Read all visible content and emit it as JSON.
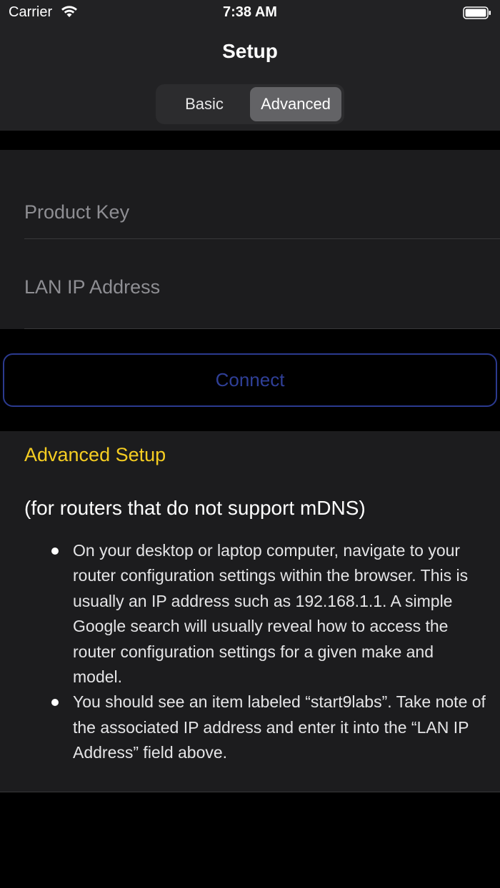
{
  "status_bar": {
    "carrier": "Carrier",
    "time": "7:38 AM",
    "wifi_icon": "wifi-icon",
    "battery_icon": "battery-icon"
  },
  "header": {
    "title": "Setup",
    "segments": [
      "Basic",
      "Advanced"
    ],
    "selected_segment": "Advanced"
  },
  "form": {
    "product_key": {
      "placeholder": "Product Key",
      "value": ""
    },
    "lan_ip": {
      "placeholder": "LAN IP Address",
      "value": ""
    }
  },
  "connect_label": "Connect",
  "info": {
    "title": "Advanced Setup",
    "subtitle": "(for routers that do not support mDNS)",
    "bullets": [
      "On your desktop or laptop computer, navigate to your router configuration settings within the browser. This is usually an IP address such as 192.168.1.1. A simple Google search will usually reveal how to access the router configuration settings for a given make and model.",
      "You should see an item labeled “start9labs”. Take note of the associated IP address and enter it into the “LAN IP Address” field above."
    ]
  },
  "colors": {
    "accent_yellow": "#f5cd22",
    "button_blue": "#2f3f97",
    "background": "#000000",
    "panel": "#1c1c1e"
  }
}
